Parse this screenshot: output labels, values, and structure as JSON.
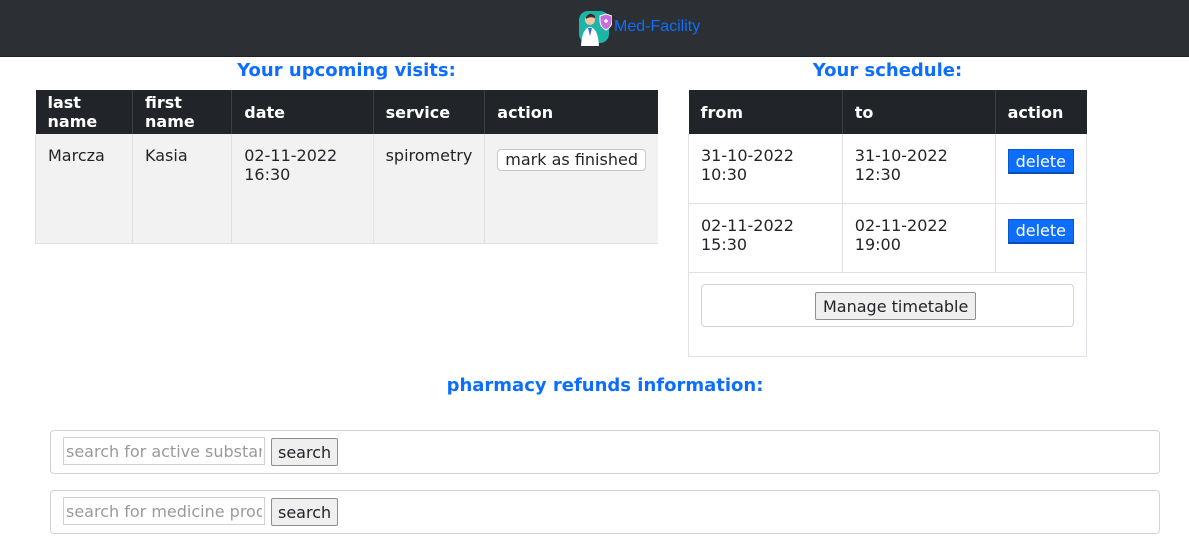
{
  "navbar": {
    "brand": "Med-Facility",
    "logo_icon": "doctor-shield-icon"
  },
  "visits": {
    "heading": "Your upcoming visits:",
    "columns": [
      "last name",
      "first name",
      "date",
      "service",
      "action"
    ],
    "rows": [
      {
        "last_name": "Marcza",
        "first_name": "Kasia",
        "date": "02-11-2022 16:30",
        "service": "spirometry",
        "action_label": "mark as finished"
      }
    ]
  },
  "schedule": {
    "heading": "Your schedule:",
    "columns": [
      "from",
      "to",
      "action"
    ],
    "rows": [
      {
        "from": "31-10-2022 10:30",
        "to": "31-10-2022 12:30",
        "action_label": "delete"
      },
      {
        "from": "02-11-2022 15:30",
        "to": "02-11-2022 19:00",
        "action_label": "delete"
      }
    ],
    "manage_label": "Manage timetable"
  },
  "pharmacy": {
    "heading": "pharmacy refunds information:",
    "substance_search": {
      "placeholder": "search for active substance",
      "value": "",
      "button_label": "search"
    },
    "product_search": {
      "placeholder": "search for medicine product",
      "value": "",
      "button_label": "search"
    }
  },
  "colors": {
    "accent": "#0d6efd",
    "navbar_bg": "#2c3034",
    "table_header_bg": "#212529"
  }
}
